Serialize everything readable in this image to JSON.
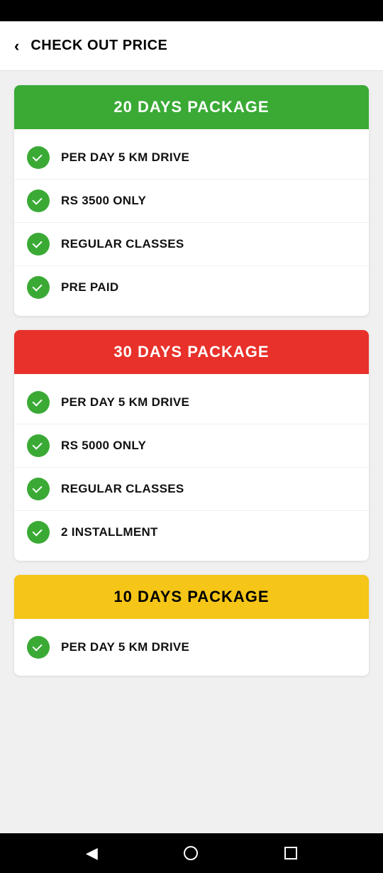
{
  "statusBar": {},
  "header": {
    "back_label": "‹",
    "title": "CHECK OUT PRICE"
  },
  "packages": [
    {
      "id": "pkg-20",
      "header_label": "20 DAYS PACKAGE",
      "header_color": "green",
      "features": [
        {
          "text": "PER DAY 5 KM DRIVE"
        },
        {
          "text": "RS 3500 ONLY"
        },
        {
          "text": "REGULAR CLASSES"
        },
        {
          "text": "PRE PAID"
        }
      ]
    },
    {
      "id": "pkg-30",
      "header_label": "30 DAYS PACKAGE",
      "header_color": "red",
      "features": [
        {
          "text": "PER DAY 5 KM DRIVE"
        },
        {
          "text": "RS 5000 ONLY"
        },
        {
          "text": "REGULAR CLASSES"
        },
        {
          "text": "2 INSTALLMENT"
        }
      ]
    },
    {
      "id": "pkg-10",
      "header_label": "10 DAYS PACKAGE",
      "header_color": "yellow",
      "features": [
        {
          "text": "PER DAY 5 KM DRIVE"
        }
      ],
      "partial": true
    }
  ],
  "bottomNav": {
    "back_symbol": "◀",
    "home_symbol": "●",
    "recent_symbol": "■"
  }
}
